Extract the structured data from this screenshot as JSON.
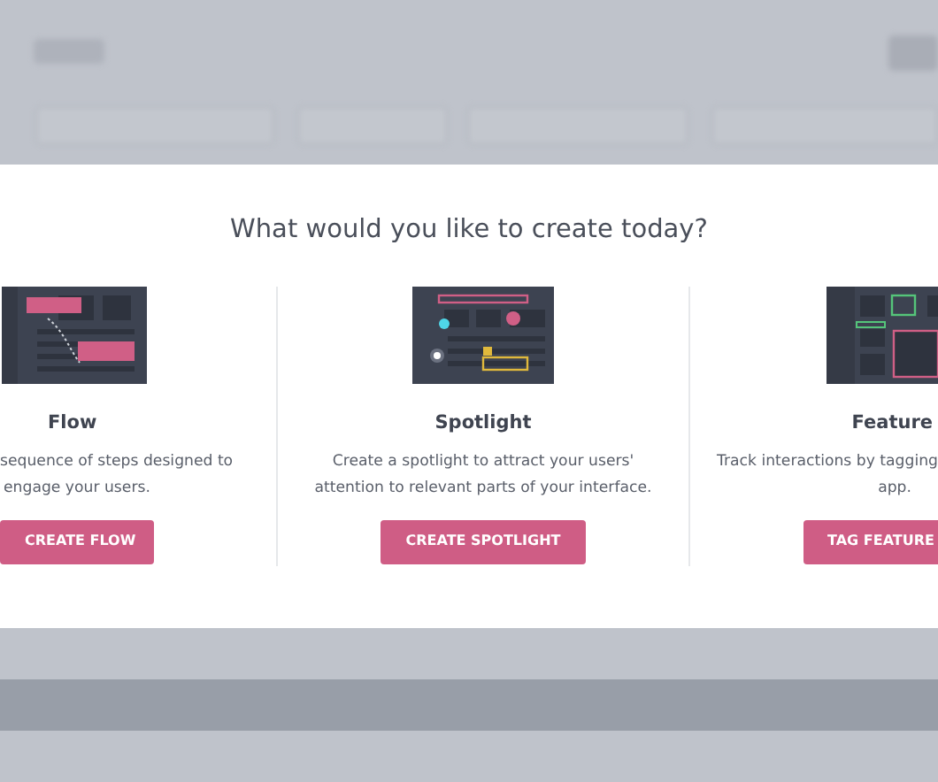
{
  "modal": {
    "heading": "What would you like to create today?",
    "options": [
      {
        "kind": "flow",
        "title": "Flow",
        "description_lines": [
          "sequence of steps designed to",
          "engage your users."
        ],
        "button": "CREATE FLOW"
      },
      {
        "kind": "spotlight",
        "title": "Spotlight",
        "description_lines": [
          "Create a spotlight to attract your users'",
          "attention to relevant parts of your interface."
        ],
        "button": "CREATE SPOTLIGHT"
      },
      {
        "kind": "feature",
        "title": "Feature",
        "description_lines": [
          "Track interactions by tagging",
          "app."
        ],
        "button": "TAG FEATURE"
      }
    ]
  }
}
